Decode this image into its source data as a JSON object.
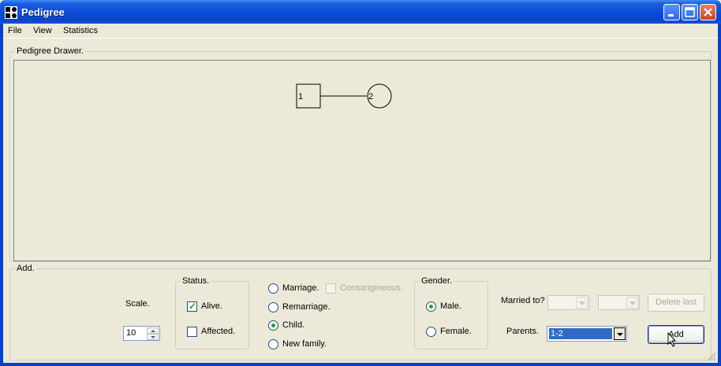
{
  "window": {
    "title": "Pedigree"
  },
  "menu": {
    "items": [
      "File",
      "View",
      "Statistics"
    ]
  },
  "drawer": {
    "label": "Pedigree Drawer.",
    "nodes": [
      {
        "label": "1",
        "shape": "square"
      },
      {
        "label": "2",
        "shape": "circle"
      }
    ]
  },
  "add_panel": {
    "label": "Add.",
    "scale": {
      "label": "Scale.",
      "value": "10"
    },
    "status": {
      "label": "Status.",
      "alive": {
        "label": "Alive.",
        "checked": true
      },
      "affected": {
        "label": "Affected.",
        "checked": false
      }
    },
    "relation": {
      "marriage": "Marriage.",
      "consanguineous": "Consangineous.",
      "remarriage": "Remarriage.",
      "child": "Child.",
      "new_family": "New family.",
      "selected": "Child."
    },
    "gender": {
      "label": "Gender.",
      "male": "Male.",
      "female": "Female.",
      "selected": "Male."
    },
    "married_to": {
      "label": "Married to?",
      "value1": "",
      "value2": ""
    },
    "parents": {
      "label": "Parents.",
      "value": "1-2"
    },
    "buttons": {
      "delete_last": "Delete last",
      "add": "Add"
    }
  },
  "colors": {
    "titlebar": "#0a45c9",
    "face": "#ece9d8",
    "selection": "#316ac5",
    "check": "#21a121"
  }
}
